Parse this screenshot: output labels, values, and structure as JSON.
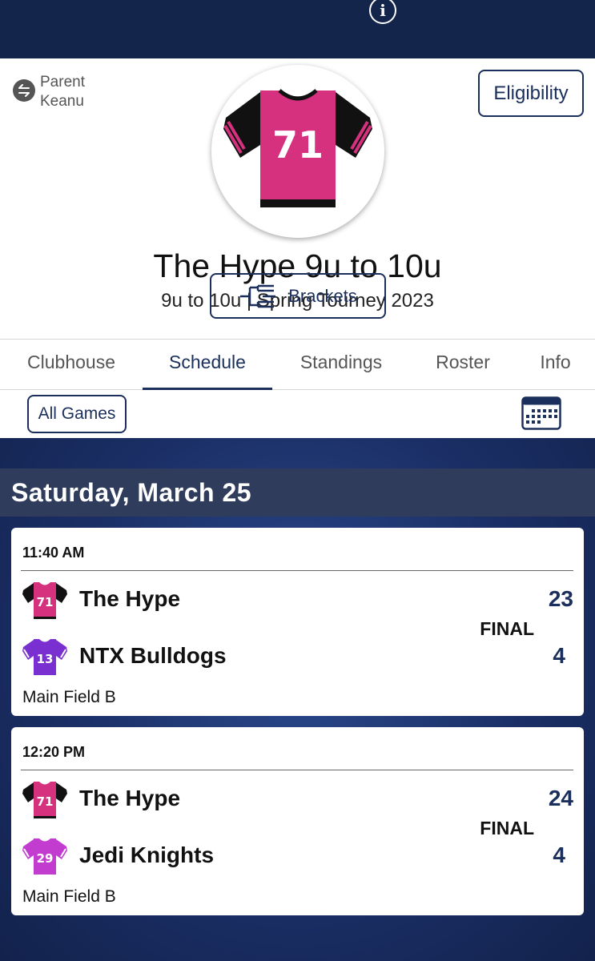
{
  "header": {
    "info_icon": "info-icon",
    "switch_user": {
      "line1": "Parent",
      "line2": "Keanu",
      "icon": "switch-arrows-icon"
    },
    "eligibility_label": "Eligibility",
    "team_logo_number": "71",
    "team_name": "The Hype 9u to 10u",
    "team_subtitle": "9u to 10u | Spring Tourney 2023",
    "brackets_label": "Brackets"
  },
  "tabs": [
    {
      "label": "Clubhouse"
    },
    {
      "label": "Schedule",
      "active": true
    },
    {
      "label": "Standings"
    },
    {
      "label": "Roster"
    },
    {
      "label": "Info"
    }
  ],
  "filter": {
    "all_games_label": "All Games",
    "calendar_icon": "calendar-icon"
  },
  "schedule": {
    "date": "Saturday, March 25",
    "games": [
      {
        "time": "11:40 AM",
        "status": "FINAL",
        "venue": "Main Field B",
        "home": {
          "name": "The Hype",
          "number": "71",
          "score": "23",
          "jersey_color": "#d6317f",
          "sleeve_color": "#111111"
        },
        "away": {
          "name": "NTX Bulldogs",
          "number": "13",
          "score": "4",
          "jersey_color": "#7a2fd0",
          "sleeve_color": "#7a2fd0"
        }
      },
      {
        "time": "12:20 PM",
        "status": "FINAL",
        "venue": "Main Field B",
        "home": {
          "name": "The Hype",
          "number": "71",
          "score": "24",
          "jersey_color": "#d6317f",
          "sleeve_color": "#111111"
        },
        "away": {
          "name": "Jedi Knights",
          "number": "29",
          "score": "4",
          "jersey_color": "#c23cd0",
          "sleeve_color": "#c23cd0"
        }
      }
    ]
  },
  "colors": {
    "navy": "#13254a",
    "accent": "#1b2f5c",
    "date_bar": "#2f3c5b",
    "hype_pink": "#d6317f"
  }
}
